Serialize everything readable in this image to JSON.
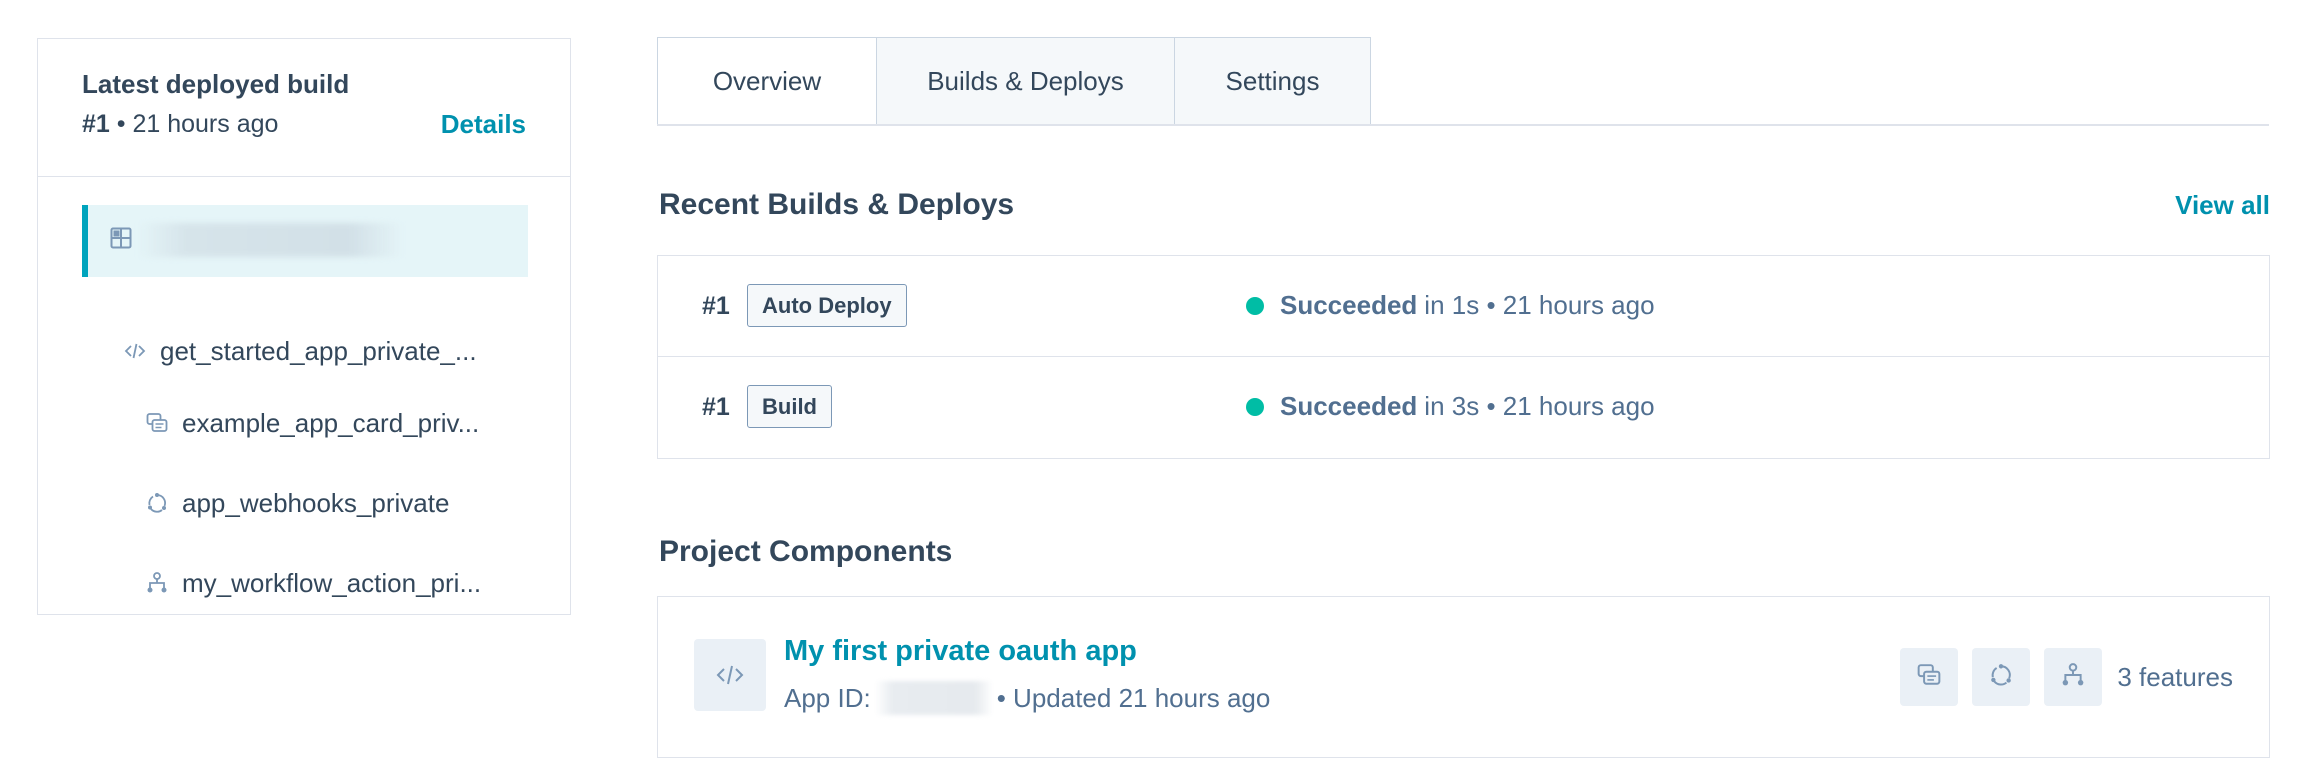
{
  "latest_build": {
    "title": "Latest deployed build",
    "build_number": "#1",
    "separator": " • ",
    "time": "21 hours ago",
    "details_link": "Details"
  },
  "tree": {
    "items": [
      {
        "label": "get_started_app_private_...",
        "icon": "code-icon"
      },
      {
        "label": "example_app_card_priv...",
        "icon": "cards-icon"
      },
      {
        "label": "app_webhooks_private",
        "icon": "webhooks-icon"
      },
      {
        "label": "my_workflow_action_pri...",
        "icon": "workflow-icon"
      }
    ]
  },
  "tabs": [
    {
      "label": "Overview",
      "active": true
    },
    {
      "label": "Builds & Deploys",
      "active": false
    },
    {
      "label": "Settings",
      "active": false
    }
  ],
  "recent": {
    "title": "Recent Builds & Deploys",
    "view_all": "View all",
    "rows": [
      {
        "number": "#1",
        "tag": "Auto Deploy",
        "status": "Succeeded",
        "detail": "in 1s • 21 hours ago"
      },
      {
        "number": "#1",
        "tag": "Build",
        "status": "Succeeded",
        "detail": "in 3s • 21 hours ago"
      }
    ]
  },
  "components": {
    "title": "Project Components",
    "card": {
      "name": "My first private oauth app",
      "app_id_label": "App ID:",
      "updated": "• Updated 21 hours ago",
      "features_count": "3 features"
    }
  },
  "colors": {
    "accent": "#0091ae",
    "success": "#00bda5",
    "text": "#33475b",
    "border": "#dfe3eb"
  }
}
